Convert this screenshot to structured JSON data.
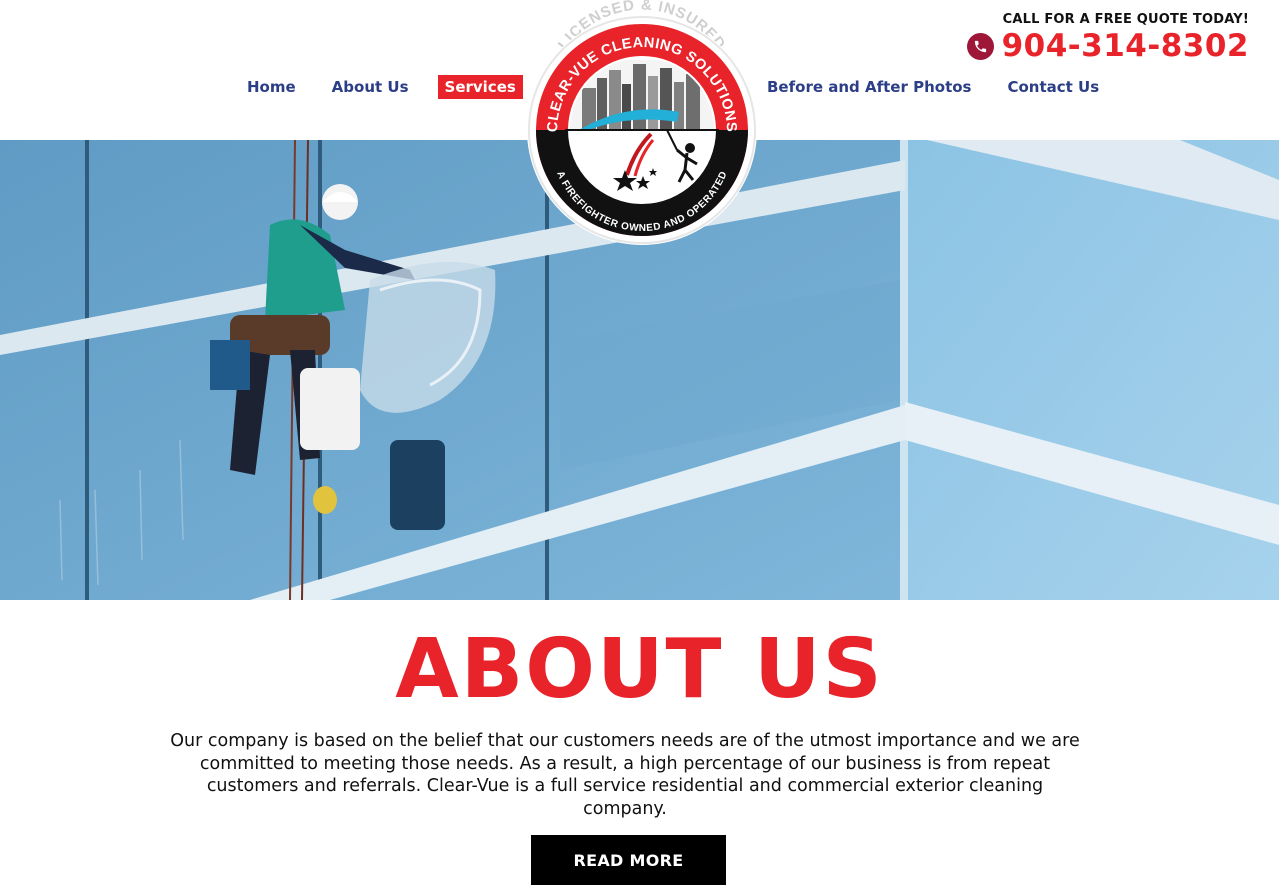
{
  "nav": {
    "left": [
      {
        "label": "Home",
        "active": false
      },
      {
        "label": "About Us",
        "active": false
      },
      {
        "label": "Services",
        "active": true
      }
    ],
    "right": [
      {
        "label": "Before and After Photos",
        "active": false
      },
      {
        "label": "Contact Us",
        "active": false
      }
    ]
  },
  "contact": {
    "cta": "CALL FOR A FREE QUOTE TODAY!",
    "phone": "904-314-8302",
    "icon": "phone-icon"
  },
  "logo": {
    "top_arc": "LICENSED & INSURED",
    "brand_arc": "CLEAR-VUE CLEANING SOLUTIONS",
    "bottom_arc": "A FIREFIGHTER OWNED AND OPERATED"
  },
  "hero": {
    "image": "window-cleaner-on-glass-building"
  },
  "about": {
    "title": "ABOUT US",
    "body": "Our company is based on the belief that our customers needs are of the utmost importance and we are committed to meeting those needs. As a result, a high percentage of our business is from repeat customers and referrals. Clear-Vue is a full service residential and commercial exterior cleaning company.",
    "button": "READ MORE"
  },
  "colors": {
    "accent": "#e8232a",
    "nav": "#2b3e86",
    "phone_icon_bg": "#9e1638",
    "button_bg": "#000000"
  }
}
